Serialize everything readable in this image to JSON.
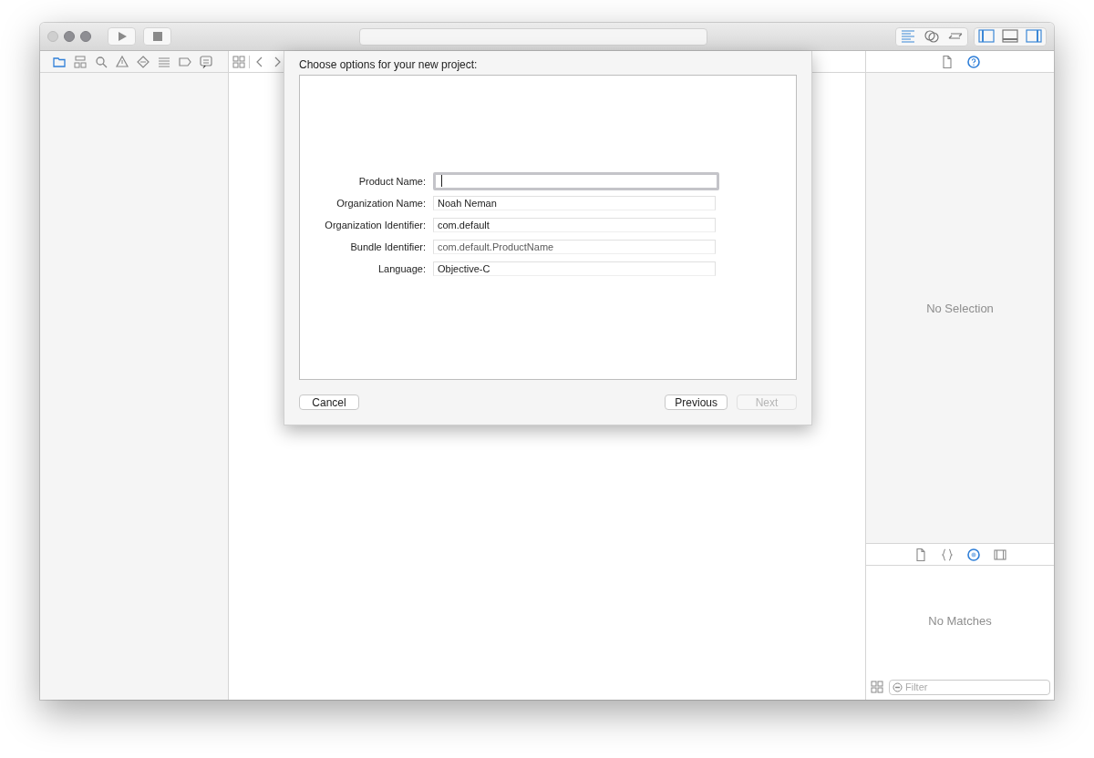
{
  "toolbar": {
    "editor_modes": [
      {
        "selected": true
      },
      {
        "selected": false
      },
      {
        "selected": false
      }
    ],
    "view_toggles": [
      {
        "on": true
      },
      {
        "on": false
      },
      {
        "on": true
      }
    ]
  },
  "navigator": {
    "tabs": [
      {
        "selected": true
      },
      {
        "selected": false
      },
      {
        "selected": false
      },
      {
        "selected": false
      },
      {
        "selected": false
      },
      {
        "selected": false
      },
      {
        "selected": false
      },
      {
        "selected": false
      }
    ]
  },
  "inspector": {
    "tabs": [
      {
        "selected": false
      },
      {
        "selected": true
      }
    ],
    "empty_text": "No Selection"
  },
  "library": {
    "tabs": [
      {
        "selected": false
      },
      {
        "selected": false
      },
      {
        "selected": true
      },
      {
        "selected": false
      }
    ],
    "empty_text": "No Matches",
    "filter": {
      "placeholder": "Filter"
    }
  },
  "dialog": {
    "title": "Choose options for your new project:",
    "fields": [
      {
        "label": "Product Name:",
        "focused": true,
        "kind": "text"
      },
      {
        "label": "Organization Name:",
        "value": "Noah Neman",
        "focused": false,
        "kind": "text"
      },
      {
        "label": "Organization Identifier:",
        "value": "com.default",
        "focused": false,
        "kind": "text"
      },
      {
        "label": "Bundle Identifier:",
        "value": "com.default.ProductName",
        "focused": false,
        "kind": "derived"
      },
      {
        "label": "Language:",
        "value": "Objective-C",
        "focused": false,
        "kind": "text"
      }
    ],
    "buttons": [
      {
        "label": "Cancel",
        "disabled": false,
        "kind": "left"
      },
      {
        "label": "Previous",
        "disabled": false,
        "kind": "right"
      },
      {
        "label": "Next",
        "disabled": true,
        "kind": "right"
      }
    ]
  }
}
